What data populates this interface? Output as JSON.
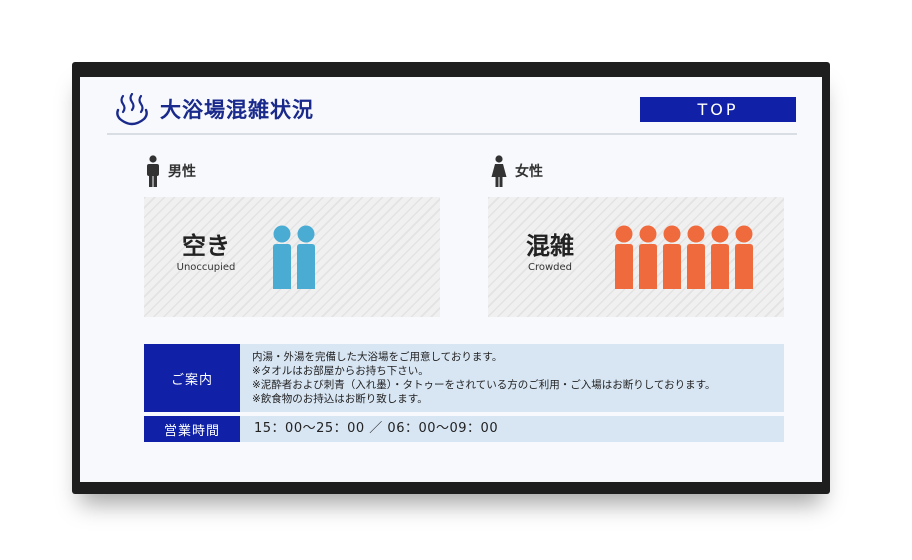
{
  "header": {
    "title": "大浴場混雑状況",
    "top_button": "TOP"
  },
  "men": {
    "label": "男性",
    "status": "空き",
    "status_en": "Unoccupied",
    "people_count": 2,
    "color": "#4aabd3"
  },
  "women": {
    "label": "女性",
    "status": "混雑",
    "status_en": "Crowded",
    "people_count": 6,
    "color": "#ef6a3d"
  },
  "info": {
    "guide_label": "ご案内",
    "guide_lines": [
      "内湯・外湯を完備した大浴場をご用意しております。",
      "※タオルはお部屋からお持ち下さい。",
      "※泥酔者および刺青（入れ墨）・タトゥーをされている方のご利用・ご入場はお断りしております。",
      "※飲食物のお持込はお断り致します。"
    ],
    "hours_label": "営業時間",
    "hours_value": "15：00～25：00 ／ 06：00～09：00"
  },
  "colors": {
    "accent": "#1021a8",
    "title": "#1a2a8c",
    "info_bg": "#d8e6f4"
  }
}
